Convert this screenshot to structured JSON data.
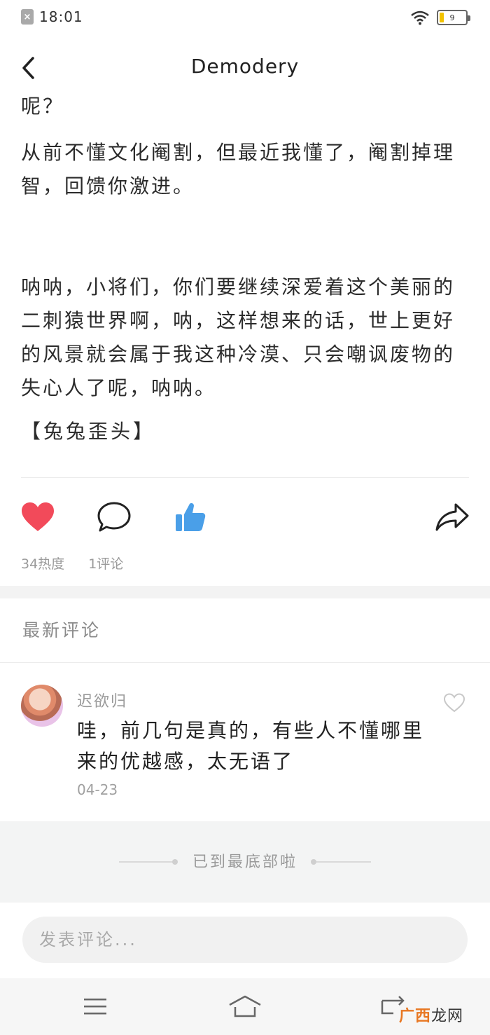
{
  "status_bar": {
    "time": "18:01",
    "battery_level": "9",
    "notification_icon": "x-icon",
    "wifi_icon": "wifi-icon",
    "battery_color": "#f2c200"
  },
  "header": {
    "title": "Demodery",
    "back_icon": "chevron-left-icon"
  },
  "article": {
    "paragraphs": [
      "呢？",
      "从前不懂文化阉割，但最近我懂了，阉割掉理智，回馈你激进。",
      "呐呐，小将们，你们要继续深爱着这个美丽的二刺猿世界啊，呐，这样想来的话，世上更好的风景就会属于我这种冷漠、只会嘲讽废物的失心人了呢，呐呐。"
    ],
    "signature": "【兔兔歪头】"
  },
  "actions": {
    "like_icon": "heart-icon",
    "comment_icon": "comment-bubble-icon",
    "thumb_icon": "thumbs-up-icon",
    "share_icon": "share-arrow-icon",
    "like_color": "#f24a5a",
    "thumb_color": "#4a9fe8"
  },
  "stats": {
    "heat": "34热度",
    "comments": "1评论"
  },
  "comments_section": {
    "title": "最新评论",
    "items": [
      {
        "user": "迟欲归",
        "text": "哇，前几句是真的，有些人不懂哪里来的优越感，太无语了",
        "date": "04-23"
      }
    ]
  },
  "end_text": "已到最底部啦",
  "input": {
    "placeholder": "发表评论..."
  },
  "watermark": {
    "part1": "广西",
    "part2": "龙网"
  }
}
